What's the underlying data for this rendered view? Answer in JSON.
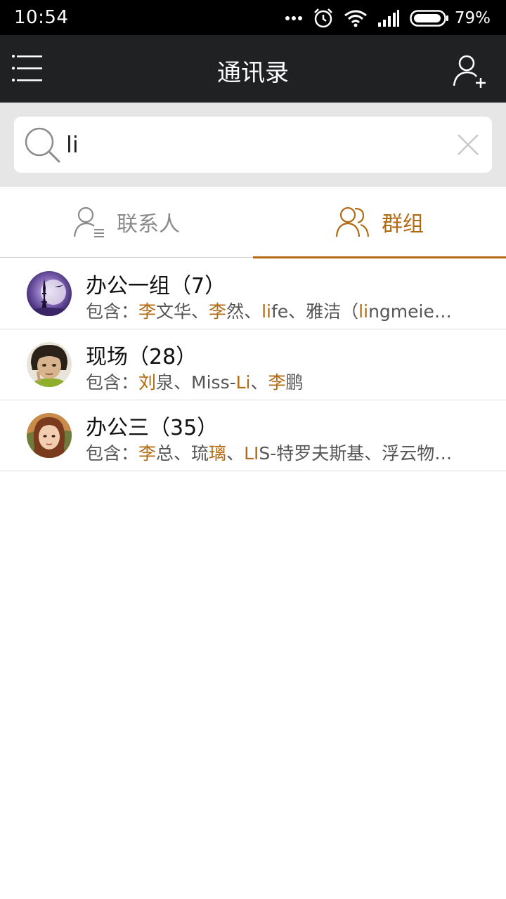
{
  "status_bar": {
    "time": "10:54",
    "battery_percent": "79%",
    "icons": [
      "more-dots-icon",
      "alarm-icon",
      "wifi-icon",
      "signal-icon",
      "battery-icon"
    ]
  },
  "app_bar": {
    "title": "通讯录",
    "menu_icon": "menu-icon",
    "add_icon": "add-contact-icon"
  },
  "search": {
    "value": "li",
    "placeholder": "",
    "icon": "search-icon",
    "clear_icon": "close-icon"
  },
  "tabs": [
    {
      "label": "联系人",
      "icon": "contacts-icon",
      "active": false
    },
    {
      "label": "群组",
      "icon": "groups-icon",
      "active": true
    }
  ],
  "colors": {
    "accent": "#b26a13",
    "app_bar": "#1f2123",
    "search_bg": "#e6e6e6"
  },
  "groups": [
    {
      "name": "办公一组（7）",
      "prefix": "包含：",
      "members": [
        {
          "text": "李",
          "hl": true
        },
        {
          "text": "文华、",
          "hl": false
        },
        {
          "text": "李",
          "hl": true
        },
        {
          "text": "然、",
          "hl": false
        },
        {
          "text": "li",
          "hl": true
        },
        {
          "text": "fe、雅洁（",
          "hl": false
        },
        {
          "text": "li",
          "hl": true
        },
        {
          "text": "ngmeie…",
          "hl": false
        }
      ]
    },
    {
      "name": "现场（28）",
      "prefix": "包含：",
      "members": [
        {
          "text": "刘",
          "hl": true
        },
        {
          "text": "泉、Miss-",
          "hl": false
        },
        {
          "text": "Li",
          "hl": true
        },
        {
          "text": "、",
          "hl": false
        },
        {
          "text": "李",
          "hl": true
        },
        {
          "text": "鹏",
          "hl": false
        }
      ]
    },
    {
      "name": "办公三（35）",
      "prefix": "包含：",
      "members": [
        {
          "text": "李",
          "hl": true
        },
        {
          "text": "总、琉",
          "hl": false
        },
        {
          "text": "璃",
          "hl": true
        },
        {
          "text": "、",
          "hl": false
        },
        {
          "text": "LI",
          "hl": true
        },
        {
          "text": "S-特罗夫斯基、浮云物…",
          "hl": false
        }
      ]
    }
  ]
}
